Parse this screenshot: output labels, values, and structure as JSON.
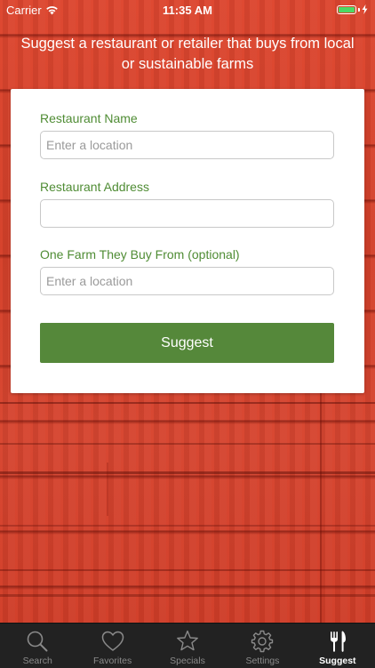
{
  "status_bar": {
    "carrier": "Carrier",
    "time": "11:35 AM"
  },
  "header": {
    "text": "Suggest a restaurant or retailer that buys from local or sustainable farms"
  },
  "form": {
    "restaurant_name": {
      "label": "Restaurant Name",
      "placeholder": "Enter a location",
      "value": ""
    },
    "restaurant_address": {
      "label": "Restaurant Address",
      "placeholder": "",
      "value": ""
    },
    "farm": {
      "label": "One Farm They Buy From (optional)",
      "placeholder": "Enter a location",
      "value": ""
    },
    "submit_label": "Suggest"
  },
  "tabs": [
    {
      "label": "Search",
      "icon": "search-icon",
      "active": false
    },
    {
      "label": "Favorites",
      "icon": "heart-icon",
      "active": false
    },
    {
      "label": "Specials",
      "icon": "star-icon",
      "active": false
    },
    {
      "label": "Settings",
      "icon": "gear-icon",
      "active": false
    },
    {
      "label": "Suggest",
      "icon": "fork-knife-icon",
      "active": true
    }
  ],
  "colors": {
    "accent_green": "#55883a",
    "label_green": "#4f8c34",
    "background_red": "#d9432c",
    "tab_bar": "#222222"
  }
}
